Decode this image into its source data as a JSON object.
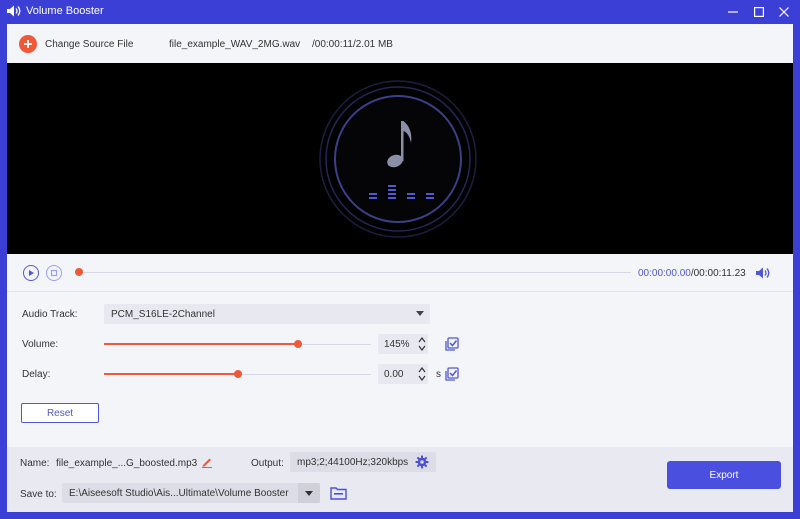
{
  "window": {
    "title": "Volume Booster",
    "accent_color": "#3b3fd6",
    "icons": [
      "speaker-icon",
      "minimize-icon",
      "maximize-icon",
      "close-icon"
    ]
  },
  "topbar": {
    "change_source_label": "Change Source File",
    "file_name": "file_example_WAV_2MG.wav",
    "file_info": "/00:00:11/2.01 MB",
    "add_icon_color": "#f0583a"
  },
  "player": {
    "current_time": "00:00:00.00",
    "total_time": "/00:00:11.23",
    "progress": 0,
    "icons": [
      "play-icon",
      "stop-icon",
      "volume-icon"
    ]
  },
  "settings": {
    "audio_track": {
      "label": "Audio Track:",
      "value": "PCM_S16LE-2Channel"
    },
    "volume": {
      "label": "Volume:",
      "value": "145%",
      "slider_fraction": 0.725
    },
    "delay": {
      "label": "Delay:",
      "value": "0.00",
      "unit": "s",
      "slider_fraction": 0.5
    },
    "reset_label": "Reset"
  },
  "output": {
    "name_label": "Name:",
    "name_value": "file_example_...G_boosted.mp3",
    "output_label": "Output:",
    "output_value": "mp3;2;44100Hz;320kbps",
    "save_label": "Save to:",
    "save_value": "E:\\Aiseesoft Studio\\Ais...Ultimate\\Volume Booster",
    "export_label": "Export"
  },
  "colors": {
    "accent": "#4a4fe0",
    "slider": "#f0583a",
    "link": "#5158d6"
  }
}
